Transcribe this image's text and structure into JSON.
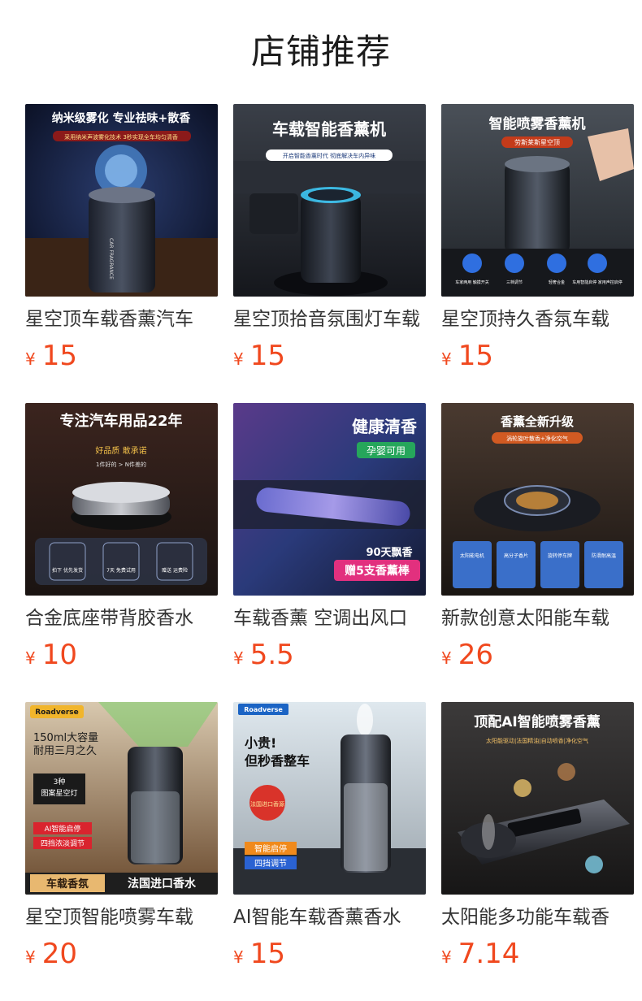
{
  "page_title": "店铺推荐",
  "currency_symbol": "¥",
  "products": [
    {
      "name": "星空顶车载香薰汽车",
      "price": "15",
      "banner": [
        "纳米级雾化  专业祛味+散香",
        "采用纳米声波雾化技术  3秒实现全车均匀清香"
      ],
      "device_text": "CAR FRAGRANCE"
    },
    {
      "name": "星空顶拾音氛围灯车载",
      "price": "15",
      "banner": [
        "车载智能香薰机",
        "开启智能香薰时代 彻底解决车内异味"
      ]
    },
    {
      "name": "星空顶持久香氛车载",
      "price": "15",
      "banner": [
        "智能喷雾香薰机",
        "劳斯莱斯星空顶"
      ],
      "icon_labels": [
        "车家两用 触摸开关",
        "三档调节",
        "轻奢合金",
        "车用智能启停 家用声控启停"
      ]
    },
    {
      "name": "合金底座带背胶香水",
      "price": "10",
      "banner": [
        "专注汽车用品22年",
        "好品质 敢承诺",
        "1件好的 > N件差的"
      ],
      "badges": [
        "拍下 优先发货",
        "7天 免费试用",
        "赠送 运费险"
      ]
    },
    {
      "name": "车载香薰 空调出风口",
      "price": "5.5",
      "banner": [
        "健康清香",
        "孕婴可用",
        "90天飘香",
        "赠5支香薰棒"
      ]
    },
    {
      "name": "新款创意太阳能车载",
      "price": "26",
      "banner": [
        "香薰全新升级",
        "涡轮旋叶散香+净化空气"
      ],
      "features": [
        "太阳能电机",
        "高分子香片",
        "旋转停车牌",
        "防滑耐高温"
      ]
    },
    {
      "name": "星空顶智能喷雾车载",
      "price": "20",
      "banner": [
        "Roadverse",
        "150ml大容量",
        "耐用三月之久",
        "3种",
        "图案星空灯",
        "AI智能启停",
        "四挡浓淡调节",
        "车载香氛",
        "法国进口香水"
      ]
    },
    {
      "name": "AI智能车载香薰香水",
      "price": "15",
      "banner": [
        "Roadverse",
        "小贵!",
        "但秒香整车",
        "智能启停",
        "四挡调节",
        "法国进口香源"
      ]
    },
    {
      "name": "太阳能多功能车载香",
      "price": "7.14",
      "banner": [
        "顶配AI智能喷雾香薰",
        "太阳能驱动|法国精油|自动喷香|净化空气"
      ]
    }
  ]
}
